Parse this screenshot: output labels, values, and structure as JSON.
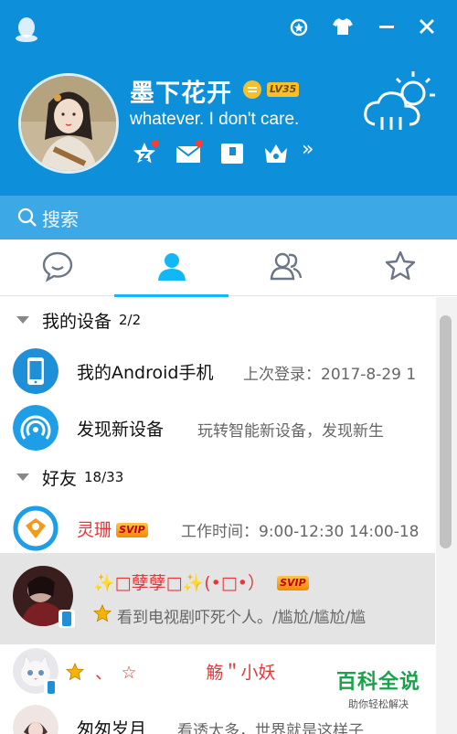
{
  "profile": {
    "nickname": "墨下花开",
    "level": "LV35",
    "signature": "whatever. I don't care."
  },
  "header": {
    "window_controls": [
      "medal-icon",
      "skin-icon",
      "minimize-icon",
      "close-icon"
    ],
    "quick_actions": [
      "qzone-icon",
      "mail-icon",
      "wallet-icon",
      "vip-crown-icon"
    ],
    "more": "»"
  },
  "search": {
    "placeholder": "搜索"
  },
  "tabs": [
    {
      "name": "messages",
      "icon": "chat-icon",
      "active": false
    },
    {
      "name": "contacts",
      "icon": "contact-icon",
      "active": true
    },
    {
      "name": "groups",
      "icon": "group-icon",
      "active": false
    },
    {
      "name": "favorites",
      "icon": "star-icon",
      "active": false
    }
  ],
  "groups": [
    {
      "title": "我的设备",
      "count": "2/2",
      "items": [
        {
          "name": "我的Android手机",
          "desc": "上次登录：2017-8-29 1"
        },
        {
          "name": "发现新设备",
          "desc": "玩转智能新设备，发现新生"
        }
      ]
    },
    {
      "title": "好友",
      "count": "18/33",
      "items": [
        {
          "name": "灵珊",
          "badge": "SVIP",
          "desc": "工作时间：9:00-12:30 14:00-18"
        },
        {
          "name": "✨□孽孽□✨(•□•）",
          "badge": "SVIP",
          "desc": "看到电视剧吓死个人。/尴尬/尴尬/尴"
        },
        {
          "name": "、　☆　　　　觞＂小妖",
          "desc": ""
        },
        {
          "name": "匆匆岁月",
          "desc": "看透太多，世界就是这样子"
        }
      ]
    }
  ],
  "watermark": {
    "main": "百科全说",
    "sub": "助你轻松解决"
  },
  "colors": {
    "header": "#0e8fd9",
    "search": "#3ca8e6",
    "accent": "#12b7f5",
    "svip": "#f08a00",
    "vip_name": "#e4393c"
  }
}
